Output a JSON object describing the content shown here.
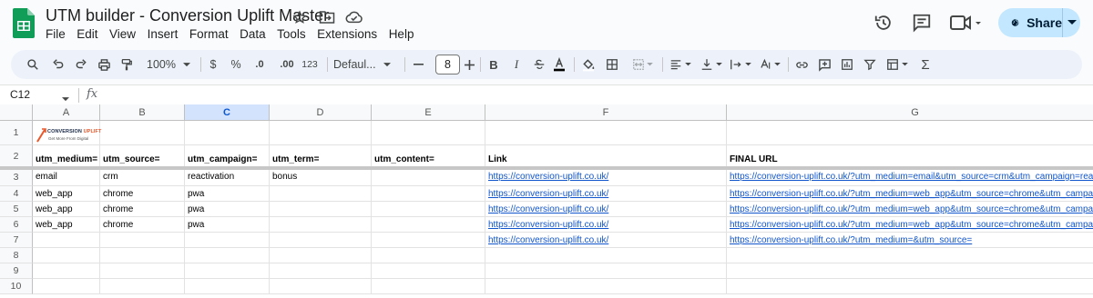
{
  "app": {
    "title": "UTM builder - Conversion Uplift Master",
    "menu": [
      "File",
      "Edit",
      "View",
      "Insert",
      "Format",
      "Data",
      "Tools",
      "Extensions",
      "Help"
    ],
    "share_label": "Share",
    "accent": "#c2e7ff",
    "icons": [
      "star-icon",
      "move-to-folder-icon",
      "cloud-saved-icon",
      "history-icon",
      "comments-icon",
      "meet-icon",
      "globe-icon"
    ]
  },
  "toolbar": {
    "zoom": "100%",
    "currency": "$",
    "percent": "%",
    "decrease_decimal": ".0",
    "increase_decimal": ".00",
    "number_format": "123",
    "font": "Defaul...",
    "font_size": "8"
  },
  "formula_bar": {
    "name_box": "C12",
    "fx": "fx",
    "value": ""
  },
  "sheet": {
    "columns": [
      "A",
      "B",
      "C",
      "D",
      "E",
      "F",
      "G"
    ],
    "selected_column": "C",
    "rows": [
      "1",
      "2",
      "3",
      "4",
      "5",
      "6",
      "7",
      "8",
      "9",
      "10"
    ],
    "logo": {
      "line1_a": "CONVERSION ",
      "line1_b": "UPLIFT",
      "line2": "Get More From Digital"
    },
    "headers": [
      "utm_medium=",
      "utm_source=",
      "utm_campaign=",
      "utm_term=",
      "utm_content=",
      "Link",
      "FINAL URL"
    ],
    "data": [
      [
        "email",
        "crm",
        "reactivation",
        "bonus",
        "",
        "https://conversion-uplift.co.uk/",
        "https://conversion-uplift.co.uk/?utm_medium=email&utm_source=crm&utm_campaign=reactivation&utm"
      ],
      [
        "web_app",
        "chrome",
        "pwa",
        "",
        "",
        "https://conversion-uplift.co.uk/",
        "https://conversion-uplift.co.uk/?utm_medium=web_app&utm_source=chrome&utm_campaign=pwa"
      ],
      [
        "web_app",
        "chrome",
        "pwa",
        "",
        "",
        "https://conversion-uplift.co.uk/",
        "https://conversion-uplift.co.uk/?utm_medium=web_app&utm_source=chrome&utm_campaign=pwa"
      ],
      [
        "web_app",
        "chrome",
        "pwa",
        "",
        "",
        "https://conversion-uplift.co.uk/",
        "https://conversion-uplift.co.uk/?utm_medium=web_app&utm_source=chrome&utm_campaign=pwa"
      ],
      [
        "",
        "",
        "",
        "",
        "",
        "https://conversion-uplift.co.uk/",
        "https://conversion-uplift.co.uk/?utm_medium=&utm_source="
      ]
    ]
  }
}
